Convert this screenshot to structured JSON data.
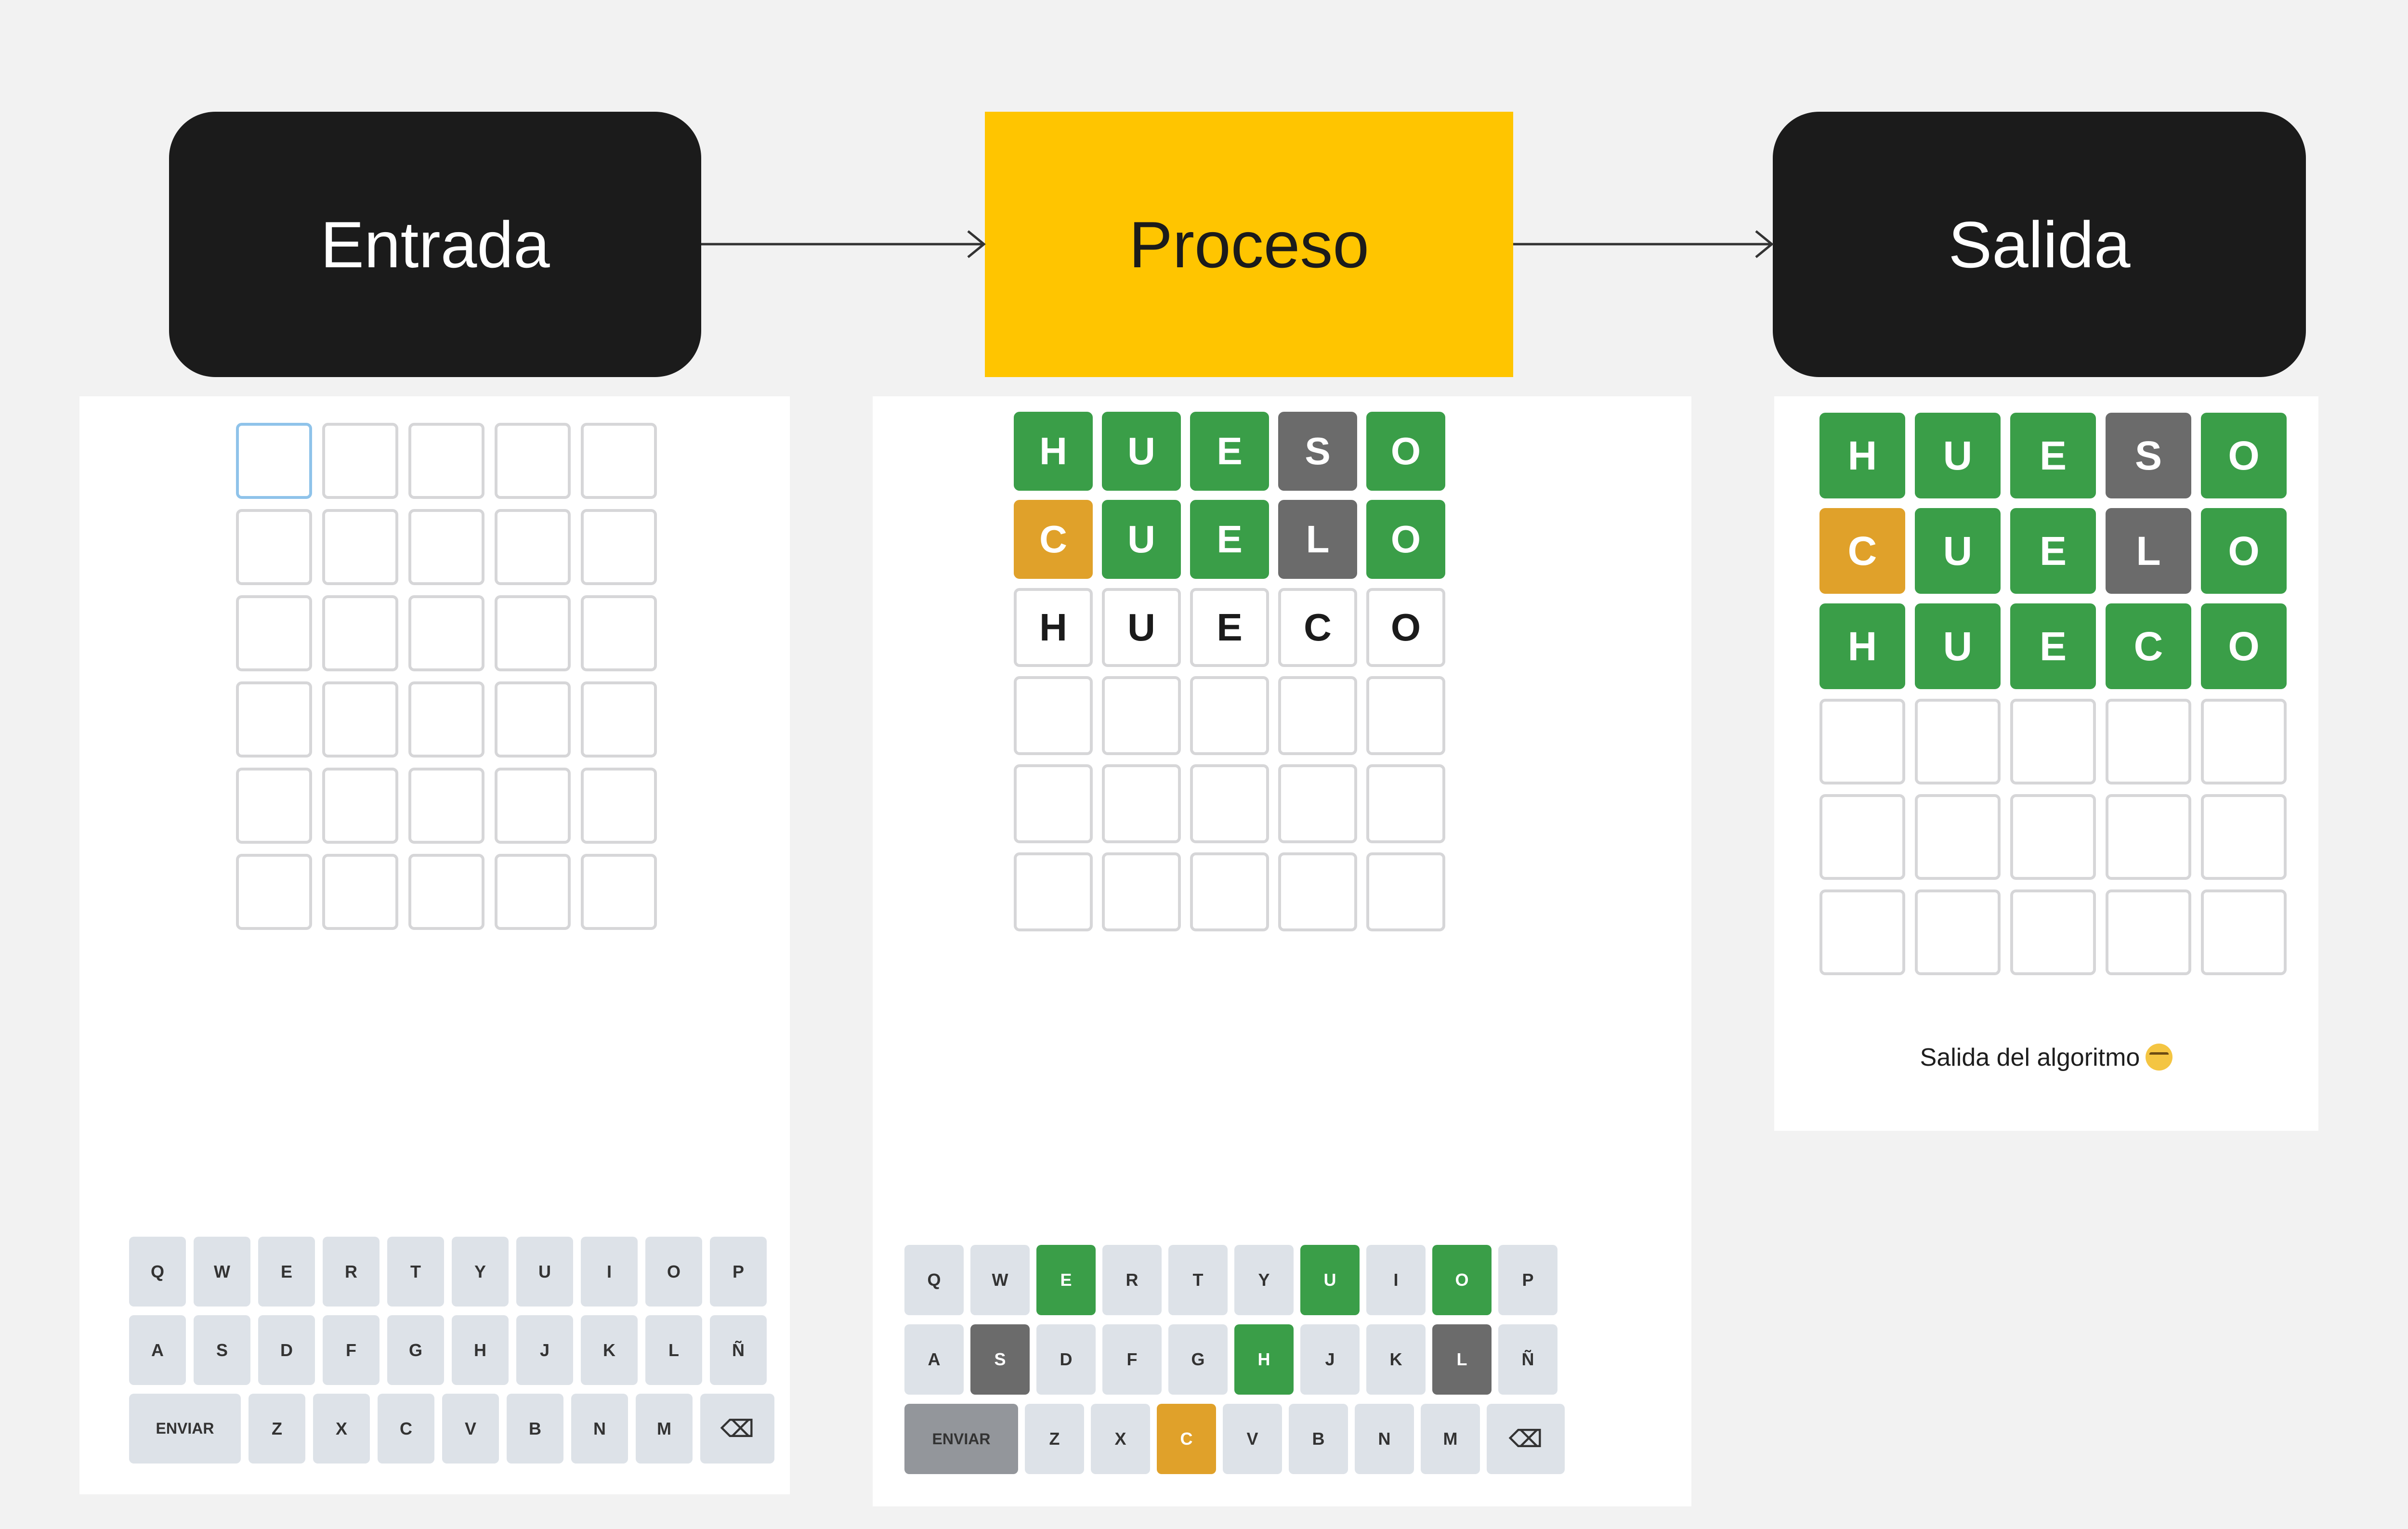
{
  "steps": [
    {
      "label": "Entrada",
      "style": "dark"
    },
    {
      "label": "Proceso",
      "style": "gold"
    },
    {
      "label": "Salida",
      "style": "dark"
    }
  ],
  "entrada": {
    "board": [
      [
        "",
        "",
        "",
        "",
        ""
      ],
      [
        "",
        "",
        "",
        "",
        ""
      ],
      [
        "",
        "",
        "",
        "",
        ""
      ],
      [
        "",
        "",
        "",
        "",
        ""
      ],
      [
        "",
        "",
        "",
        "",
        ""
      ],
      [
        "",
        "",
        "",
        "",
        ""
      ]
    ],
    "states": [
      [
        "focus",
        "",
        "",
        "",
        ""
      ],
      [
        "",
        "",
        "",
        "",
        ""
      ],
      [
        "",
        "",
        "",
        "",
        ""
      ],
      [
        "",
        "",
        "",
        "",
        ""
      ],
      [
        "",
        "",
        "",
        "",
        ""
      ],
      [
        "",
        "",
        "",
        "",
        ""
      ]
    ],
    "keyboard": [
      [
        "Q",
        "W",
        "E",
        "R",
        "T",
        "Y",
        "U",
        "I",
        "O",
        "P"
      ],
      [
        "A",
        "S",
        "D",
        "F",
        "G",
        "H",
        "J",
        "K",
        "L",
        "Ñ"
      ],
      [
        "ENVIAR",
        "Z",
        "X",
        "C",
        "V",
        "B",
        "N",
        "M",
        "⌫"
      ]
    ],
    "key_states": {}
  },
  "proceso": {
    "board": [
      [
        "H",
        "U",
        "E",
        "S",
        "O"
      ],
      [
        "C",
        "U",
        "E",
        "L",
        "O"
      ],
      [
        "H",
        "U",
        "E",
        "C",
        "O"
      ],
      [
        "",
        "",
        "",
        "",
        ""
      ],
      [
        "",
        "",
        "",
        "",
        ""
      ],
      [
        "",
        "",
        "",
        "",
        ""
      ]
    ],
    "states": [
      [
        "g",
        "g",
        "g",
        "x",
        "g"
      ],
      [
        "y",
        "g",
        "g",
        "x",
        "g"
      ],
      [
        "typed",
        "typed",
        "typed",
        "typed",
        "typed"
      ],
      [
        "",
        "",
        "",
        "",
        ""
      ],
      [
        "",
        "",
        "",
        "",
        ""
      ],
      [
        "",
        "",
        "",
        "",
        ""
      ]
    ],
    "keyboard": [
      [
        "Q",
        "W",
        "E",
        "R",
        "T",
        "Y",
        "U",
        "I",
        "O",
        "P"
      ],
      [
        "A",
        "S",
        "D",
        "F",
        "G",
        "H",
        "J",
        "K",
        "L",
        "Ñ"
      ],
      [
        "ENVIAR",
        "Z",
        "X",
        "C",
        "V",
        "B",
        "N",
        "M",
        "⌫"
      ]
    ],
    "key_states": {
      "E": "g",
      "U": "g",
      "O": "g",
      "H": "g",
      "S": "x",
      "L": "x",
      "C": "y",
      "ENVIAR": "enter-dark"
    }
  },
  "salida": {
    "board": [
      [
        "H",
        "U",
        "E",
        "S",
        "O"
      ],
      [
        "C",
        "U",
        "E",
        "L",
        "O"
      ],
      [
        "H",
        "U",
        "E",
        "C",
        "O"
      ],
      [
        "",
        "",
        "",
        "",
        ""
      ],
      [
        "",
        "",
        "",
        "",
        ""
      ],
      [
        "",
        "",
        "",
        "",
        ""
      ]
    ],
    "states": [
      [
        "g",
        "g",
        "g",
        "x",
        "g"
      ],
      [
        "y",
        "g",
        "g",
        "x",
        "g"
      ],
      [
        "g",
        "g",
        "g",
        "g",
        "g"
      ],
      [
        "",
        "",
        "",
        "",
        ""
      ],
      [
        "",
        "",
        "",
        "",
        ""
      ],
      [
        "",
        "",
        "",
        "",
        ""
      ]
    ],
    "caption": "Salida del algoritmo",
    "caption_emoji": "nerd-face-emoji-icon"
  },
  "colors": {
    "correct": "#3a9e48",
    "present": "#e0a12a",
    "absent": "#6b6b6b",
    "step_dark": "#1b1b1b",
    "step_process": "#ffc500"
  }
}
